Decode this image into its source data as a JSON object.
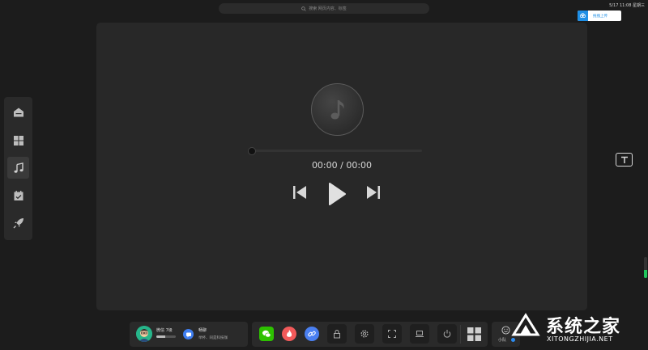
{
  "search": {
    "placeholder": "搜索 网页内容、标签",
    "icon": "search-icon"
  },
  "clock": {
    "text": "5/17 11:08 星期三"
  },
  "upload": {
    "label": "拖拽上传",
    "icon": "cloud-upload-icon",
    "color": "#1e8fe6"
  },
  "sidebar": {
    "items": [
      {
        "name": "home",
        "icon": "home-icon",
        "active": false
      },
      {
        "name": "apps",
        "icon": "grid-icon",
        "active": false
      },
      {
        "name": "music",
        "icon": "music-note-icon",
        "active": true
      },
      {
        "name": "calendar",
        "icon": "calendar-check-icon",
        "active": false
      },
      {
        "name": "rocket",
        "icon": "rocket-icon",
        "active": false
      }
    ]
  },
  "player": {
    "time_display": "00:00 / 00:00",
    "progress": 0,
    "cover_icon": "music-note-icon",
    "controls": [
      "skip-previous-icon",
      "play-icon",
      "skip-next-icon"
    ]
  },
  "right": {
    "text_tool_icon": "text-box-icon",
    "volume_level": 0.4,
    "volume_color": "#21c45b"
  },
  "dock": {
    "user": {
      "name": "微信 7级",
      "level_progress": 0.45,
      "chat_title": "畅聊",
      "chat_subtitle": "举杯、同是科技咖"
    },
    "apps": [
      {
        "name": "wechat",
        "icon": "wechat-icon",
        "color": "#2dc100"
      },
      {
        "name": "hot",
        "icon": "flame-icon",
        "color": "#f25a5a"
      },
      {
        "name": "link",
        "icon": "link-icon",
        "color": "#4a7ff0"
      }
    ],
    "tools": [
      {
        "name": "lock",
        "icon": "lock-icon"
      },
      {
        "name": "settings",
        "icon": "gear-icon"
      },
      {
        "name": "fullscreen",
        "icon": "fullscreen-icon"
      },
      {
        "name": "laptop",
        "icon": "laptop-icon"
      },
      {
        "name": "power",
        "icon": "power-icon"
      }
    ],
    "team": {
      "label": "小队",
      "icon": "smile-icon"
    }
  },
  "watermark": {
    "cn": "系统之家",
    "en": "XITONGZHIJIA.NET"
  }
}
